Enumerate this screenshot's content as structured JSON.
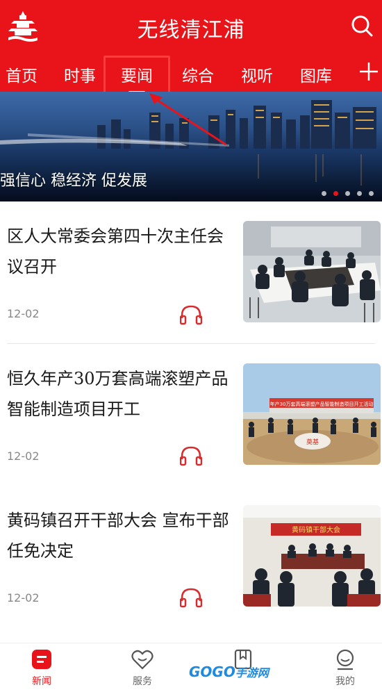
{
  "header": {
    "title": "无线清江浦",
    "colors": {
      "brand": "#e8141a"
    }
  },
  "tabs": [
    {
      "label": "首页"
    },
    {
      "label": "时事"
    },
    {
      "label": "要闻",
      "active": true
    },
    {
      "label": "综合"
    },
    {
      "label": "视听"
    },
    {
      "label": "图库"
    }
  ],
  "banner": {
    "caption": "强信心 稳经济 促发展",
    "slides_total": 5,
    "active_slide": 2
  },
  "news": [
    {
      "title": "区人大常委会第四十次主任会议召开",
      "date": "12-02"
    },
    {
      "title": "恒久年产30万套高端滚塑产品智能制造项目开工",
      "date": "12-02",
      "thumb_banner": "年产30万套高端滚塑产品智能制造项目开工活动",
      "thumb_stone": "奠基"
    },
    {
      "title": "黄码镇召开干部大会 宣布干部任免决定",
      "date": "12-02",
      "thumb_banner": "黄码镇干部大会"
    }
  ],
  "bottom_nav": [
    {
      "label": "新闻",
      "icon": "news-icon",
      "active": true
    },
    {
      "label": "服务",
      "icon": "heart-icon"
    },
    {
      "label": "",
      "icon": "bookmark-icon"
    },
    {
      "label": "我的",
      "icon": "user-icon"
    }
  ],
  "watermark": {
    "brand": "GOGO",
    "cn": "手游网"
  }
}
